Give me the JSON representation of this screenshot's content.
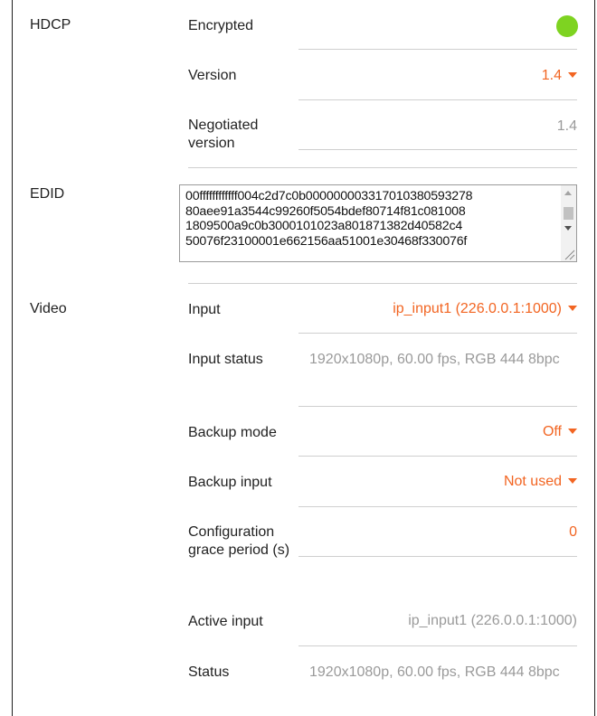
{
  "hdcp": {
    "section": "HDCP",
    "encrypted_label": "Encrypted",
    "encrypted_color": "#7ed321",
    "version_label": "Version",
    "version_value": "1.4",
    "negotiated_label": "Negotiated version",
    "negotiated_value": "1.4"
  },
  "edid": {
    "section": "EDID",
    "value": "00ffffffffffff004c2d7c0b000000003317010380593278\n80aee91a3544c99260f5054bdef80714f81c081008\n1809500a9c0b3000101023a801871382d40582c4\n50076f23100001e662156aa51001e30468f330076f"
  },
  "video": {
    "section": "Video",
    "input_label": "Input",
    "input_value": "ip_input1 (226.0.0.1:1000)",
    "input_status_label": "Input status",
    "input_status_value": "1920x1080p, 60.00 fps, RGB 444 8bpc",
    "backup_mode_label": "Backup mode",
    "backup_mode_value": "Off",
    "backup_input_label": "Backup input",
    "backup_input_value": "Not used",
    "grace_label": "Configuration grace period (s)",
    "grace_value": "0",
    "active_input_label": "Active input",
    "active_input_value": "ip_input1 (226.0.0.1:1000)",
    "status_label": "Status",
    "status_value": "1920x1080p, 60.00 fps, RGB 444 8bpc"
  },
  "colors": {
    "accent": "#f26522",
    "muted": "#9a9a9a",
    "ok": "#7ed321"
  }
}
